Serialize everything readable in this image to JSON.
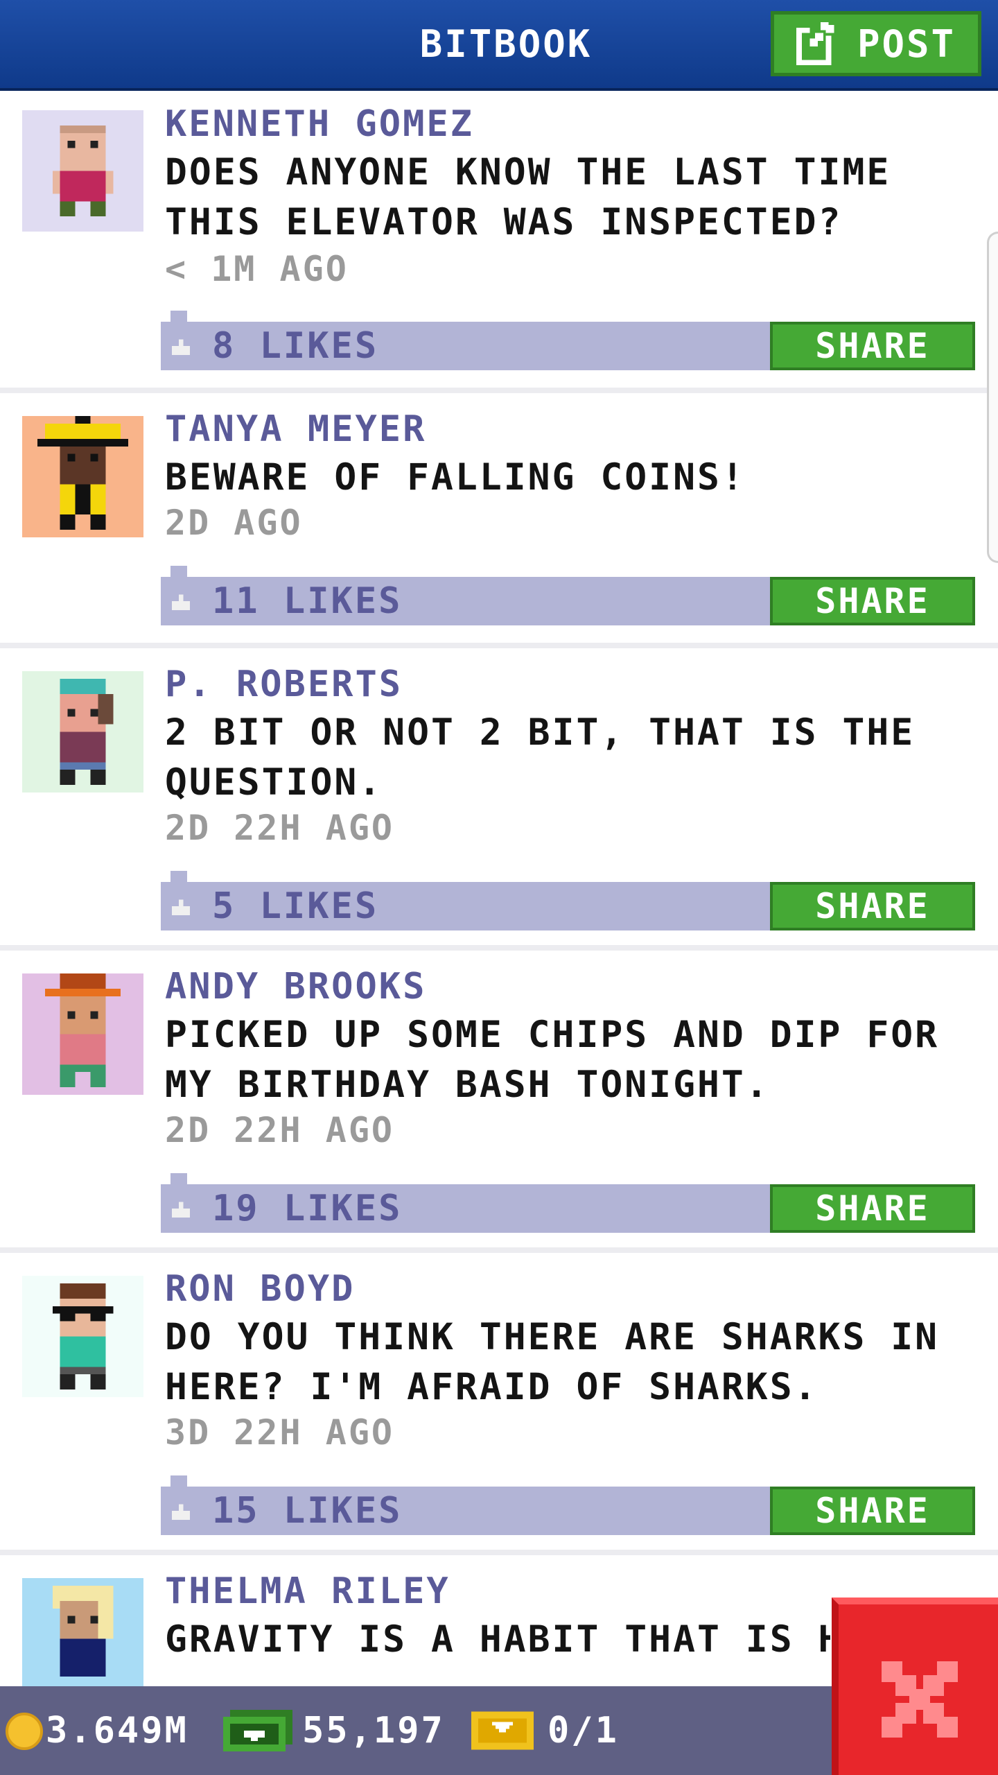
{
  "header": {
    "title": "BITBOOK",
    "post_label": "POST"
  },
  "posts": [
    {
      "name": "KENNETH GOMEZ",
      "text": "DOES ANYONE KNOW THE LAST TIME\nTHIS ELEVATOR WAS INSPECTED?",
      "time": "< 1M AGO",
      "likes": "8 LIKES",
      "share": "SHARE",
      "avatar_bg": "#e0dcf2"
    },
    {
      "name": "TANYA MEYER",
      "text": "BEWARE OF FALLING COINS!",
      "time": "2D AGO",
      "likes": "11 LIKES",
      "share": "SHARE",
      "avatar_bg": "#f9b48a"
    },
    {
      "name": "P. ROBERTS",
      "text": "2 BIT OR NOT 2 BIT, THAT IS THE\nQUESTION.",
      "time": "2D 22H AGO",
      "likes": "5 LIKES",
      "share": "SHARE",
      "avatar_bg": "#e1f5e3"
    },
    {
      "name": "ANDY BROOKS",
      "text": "PICKED UP SOME CHIPS AND DIP FOR\nMY BIRTHDAY BASH TONIGHT.",
      "time": "2D 22H AGO",
      "likes": "19 LIKES",
      "share": "SHARE",
      "avatar_bg": "#e2bfe4"
    },
    {
      "name": "RON BOYD",
      "text": "DO YOU THINK THERE ARE SHARKS IN\nHERE? I'M AFRAID OF SHARKS.",
      "time": "3D 22H AGO",
      "likes": "15 LIKES",
      "share": "SHARE",
      "avatar_bg": "#f2fdfa"
    },
    {
      "name": "THELMA RILEY",
      "text": "GRAVITY IS A HABIT THAT IS HAI",
      "avatar_bg": "#a8dcf5"
    }
  ],
  "footer": {
    "coins": "3.649M",
    "bux": "55,197",
    "tickets": "0/1"
  },
  "icons": {
    "post": "edit-icon",
    "like": "thumbs-up-icon",
    "coin": "coin-icon",
    "bux": "bux-icon",
    "ticket": "ticket-icon",
    "close": "close-icon"
  },
  "colors": {
    "header": "#1f4fa8",
    "green_button": "#45a935",
    "like_bar": "#b2b4d6",
    "name_text": "#5a5a99",
    "footer": "#5f6084",
    "close_button": "#e8262b"
  }
}
